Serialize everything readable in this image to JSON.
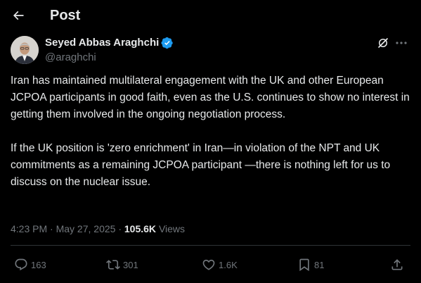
{
  "header": {
    "back_icon": "arrow-left-icon",
    "title": "Post"
  },
  "author": {
    "name": "Seyed Abbas Araghchi",
    "handle": "@araghchi",
    "verified_icon": "verified-badge-icon",
    "verified_color": "#1d9bf0"
  },
  "post": {
    "paragraphs": [
      "Iran has maintained multilateral engagement with the UK and other European JCPOA participants in good faith, even as the U.S. continues to show no interest in getting them involved in the ongoing negotiation process.",
      "If the UK position is 'zero enrichment' in Iran—in violation of the NPT and UK commitments as a remaining JCPOA participant —there is nothing left for us to discuss on the nuclear issue."
    ],
    "time": "4:23 PM",
    "separator": "·",
    "date": "May 27, 2025",
    "views_count": "105.6K",
    "views_label": "Views"
  },
  "actions": {
    "replies": "163",
    "reposts": "301",
    "likes": "1.6K",
    "bookmarks": "81"
  },
  "colors": {
    "background": "#000000",
    "text": "#e7e9ea",
    "muted": "#71767b",
    "divider": "#2f3336"
  }
}
